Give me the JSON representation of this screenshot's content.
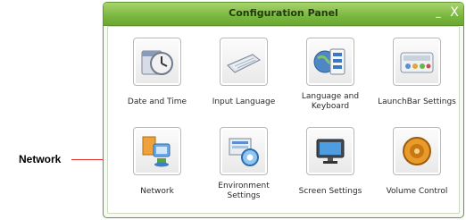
{
  "callout": {
    "label": "Network",
    "line_color": "#e0322a"
  },
  "window": {
    "title": "Configuration Panel",
    "minimize_label": "_",
    "close_label": "X",
    "accent": "#7ab73f"
  },
  "items": [
    {
      "label": "Date and Time",
      "icon": "date-time-icon"
    },
    {
      "label": "Input Language",
      "icon": "keyboard-icon"
    },
    {
      "label": "Language and Keyboard",
      "icon": "globe-document-icon"
    },
    {
      "label": "LaunchBar Settings",
      "icon": "launchbar-icon"
    },
    {
      "label": "Network",
      "icon": "network-icon"
    },
    {
      "label": "Environment Settings",
      "icon": "environment-gear-icon"
    },
    {
      "label": "Screen Settings",
      "icon": "monitor-icon"
    },
    {
      "label": "Volume Control",
      "icon": "speaker-icon"
    }
  ]
}
